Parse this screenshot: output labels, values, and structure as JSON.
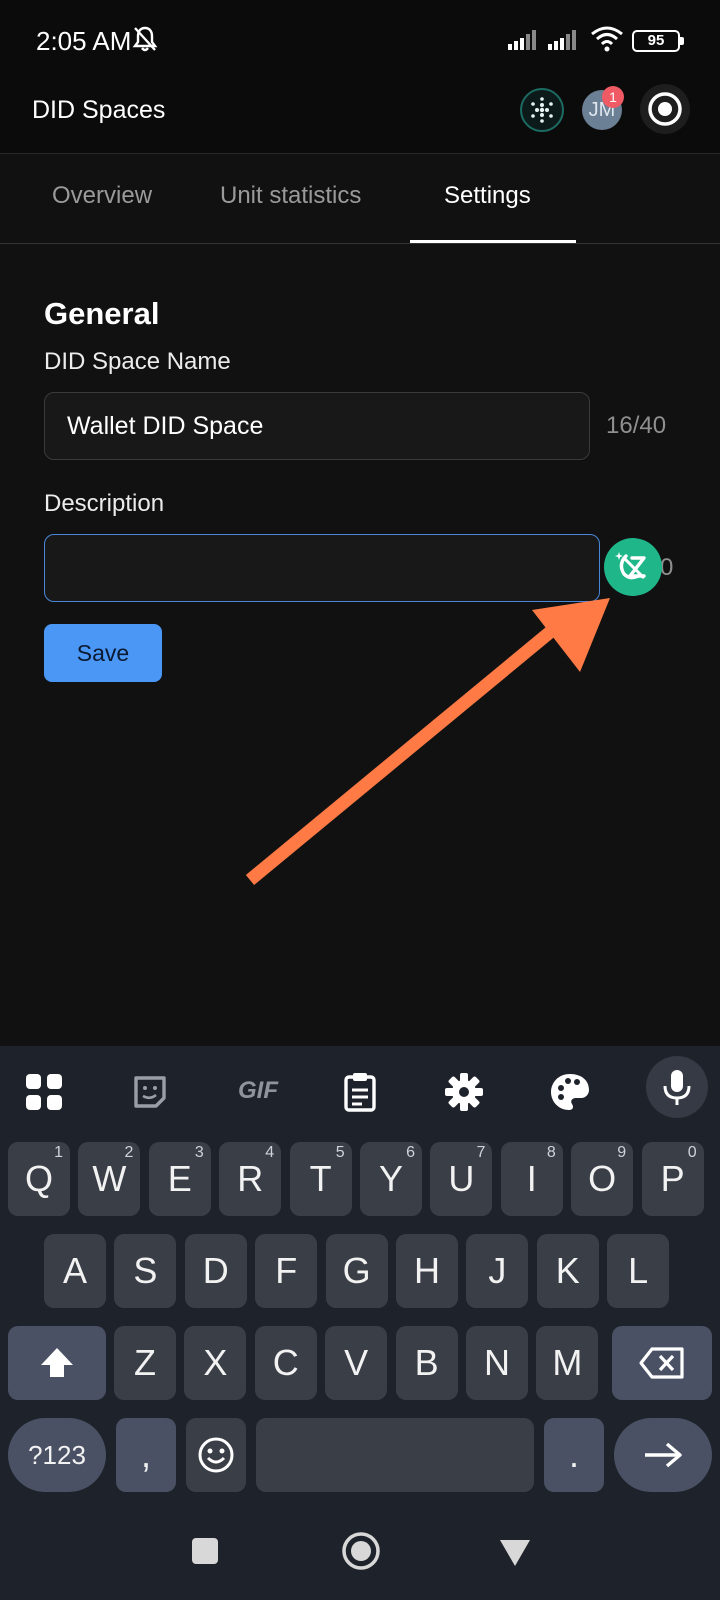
{
  "status_bar": {
    "time": "2:05 AM",
    "battery": "95"
  },
  "header": {
    "title": "DID Spaces",
    "avatar_initials": "JM",
    "notification_count": "1"
  },
  "tabs": [
    {
      "label": "Overview"
    },
    {
      "label": "Unit statistics"
    },
    {
      "label": "Settings"
    }
  ],
  "form": {
    "section_title": "General",
    "name_label": "DID Space Name",
    "name_value": "Wallet DID Space",
    "name_counter": "16/40",
    "description_label": "Description",
    "description_value": "",
    "description_counter_visible": "0",
    "save_label": "Save"
  },
  "keyboard": {
    "row1": [
      {
        "key": "Q",
        "hint": "1"
      },
      {
        "key": "W",
        "hint": "2"
      },
      {
        "key": "E",
        "hint": "3"
      },
      {
        "key": "R",
        "hint": "4"
      },
      {
        "key": "T",
        "hint": "5"
      },
      {
        "key": "Y",
        "hint": "6"
      },
      {
        "key": "U",
        "hint": "7"
      },
      {
        "key": "I",
        "hint": "8"
      },
      {
        "key": "O",
        "hint": "9"
      },
      {
        "key": "P",
        "hint": "0"
      }
    ],
    "row2": [
      "A",
      "S",
      "D",
      "F",
      "G",
      "H",
      "J",
      "K",
      "L"
    ],
    "row3": [
      "Z",
      "X",
      "C",
      "V",
      "B",
      "N",
      "M"
    ],
    "symbols_label": "?123",
    "comma_label": ",",
    "period_label": ".",
    "gif_label": "GIF"
  },
  "colors": {
    "accent": "#4a97f5",
    "annotation_arrow": "#ff7a45",
    "grammar_bubble": "#1fb68a"
  }
}
